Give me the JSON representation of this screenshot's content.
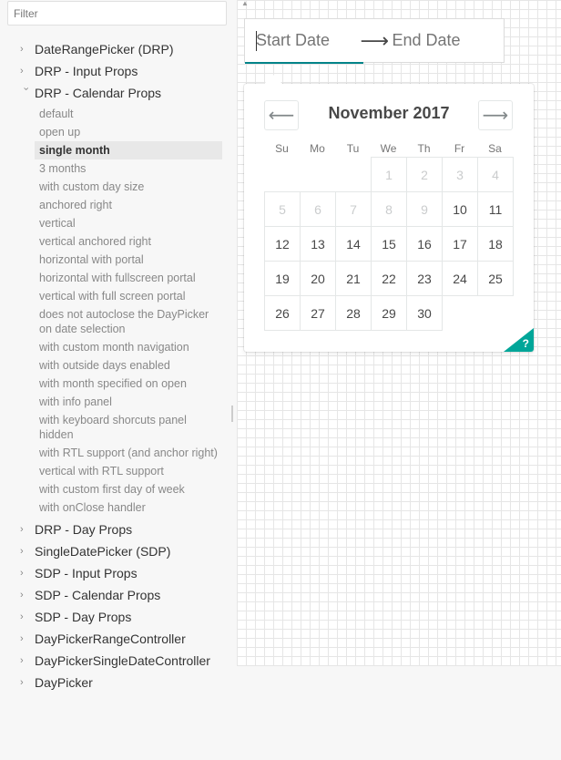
{
  "sidebar": {
    "filter_placeholder": "Filter",
    "stories": [
      {
        "label": "DateRangePicker (DRP)",
        "open": false
      },
      {
        "label": "DRP - Input Props",
        "open": false
      },
      {
        "label": "DRP - Calendar Props",
        "open": true
      },
      {
        "label": "DRP - Day Props",
        "open": false
      },
      {
        "label": "SingleDatePicker (SDP)",
        "open": false
      },
      {
        "label": "SDP - Input Props",
        "open": false
      },
      {
        "label": "SDP - Calendar Props",
        "open": false
      },
      {
        "label": "SDP - Day Props",
        "open": false
      },
      {
        "label": "DayPickerRangeController",
        "open": false
      },
      {
        "label": "DayPickerSingleDateController",
        "open": false
      },
      {
        "label": "DayPicker",
        "open": false
      }
    ],
    "calendar_props_items": [
      "default",
      "open up",
      "single month",
      "3 months",
      "with custom day size",
      "anchored right",
      "vertical",
      "vertical anchored right",
      "horizontal with portal",
      "horizontal with fullscreen portal",
      "vertical with full screen portal",
      "does not autoclose the DayPicker on date selection",
      "with custom month navigation",
      "with outside days enabled",
      "with month specified on open",
      "with info panel",
      "with keyboard shorcuts panel hidden",
      "with RTL support (and anchor right)",
      "vertical with RTL support",
      "with custom first day of week",
      "with onClose handler"
    ],
    "selected_item": "single month"
  },
  "picker": {
    "start_placeholder": "Start Date",
    "end_placeholder": "End Date",
    "arrow_icon": "right-arrow-icon"
  },
  "calendar": {
    "month_title": "November 2017",
    "prev_icon": "left-arrow-icon",
    "next_icon": "right-arrow-icon",
    "weekdays": [
      "Su",
      "Mo",
      "Tu",
      "We",
      "Th",
      "Fr",
      "Sa"
    ],
    "weeks": [
      [
        null,
        null,
        null,
        "1",
        "2",
        "3",
        "4"
      ],
      [
        "5",
        "6",
        "7",
        "8",
        "9",
        "10",
        "11"
      ],
      [
        "12",
        "13",
        "14",
        "15",
        "16",
        "17",
        "18"
      ],
      [
        "19",
        "20",
        "21",
        "22",
        "23",
        "24",
        "25"
      ],
      [
        "26",
        "27",
        "28",
        "29",
        "30",
        null,
        null
      ]
    ],
    "blocked_days": [
      "1",
      "2",
      "3",
      "4",
      "5",
      "6",
      "7",
      "8",
      "9"
    ],
    "help_label": "?",
    "accent_color": "#00a699",
    "focus_color": "#008489"
  }
}
